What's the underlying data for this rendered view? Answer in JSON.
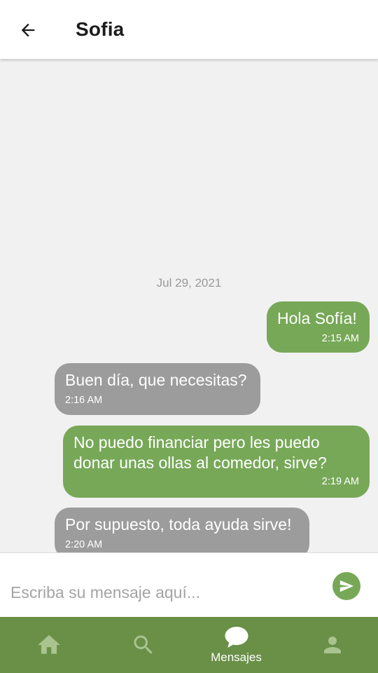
{
  "header": {
    "title": "Sofia",
    "back_icon": "arrow-left-icon"
  },
  "chat": {
    "date": "Jul 29, 2021",
    "messages": [
      {
        "sender": "me",
        "text": "Hola Sofía!",
        "time": "2:15 AM"
      },
      {
        "sender": "them",
        "text": "Buen día, que necesitas?",
        "time": "2:16 AM"
      },
      {
        "sender": "me",
        "text": "No puedo financiar pero les puedo donar unas ollas al comedor, sirve?",
        "time": "2:19 AM"
      },
      {
        "sender": "them",
        "text": "Por supuesto, toda ayuda sirve!",
        "time": "2:20 AM"
      }
    ]
  },
  "composer": {
    "placeholder": "Escriba su mensaje aquí...",
    "send_icon": "send-icon"
  },
  "nav": {
    "items": [
      {
        "icon": "home-icon",
        "label": "",
        "active": false
      },
      {
        "icon": "search-icon",
        "label": "",
        "active": false
      },
      {
        "icon": "chat-bubble-icon",
        "label": "Mensajes",
        "active": true
      },
      {
        "icon": "person-icon",
        "label": "",
        "active": false
      }
    ]
  },
  "colors": {
    "accent": "#77a858",
    "nav_background": "#6a8f47",
    "incoming_bubble": "#9c9c9c",
    "nav_inactive_icon": "#a9c48f"
  }
}
